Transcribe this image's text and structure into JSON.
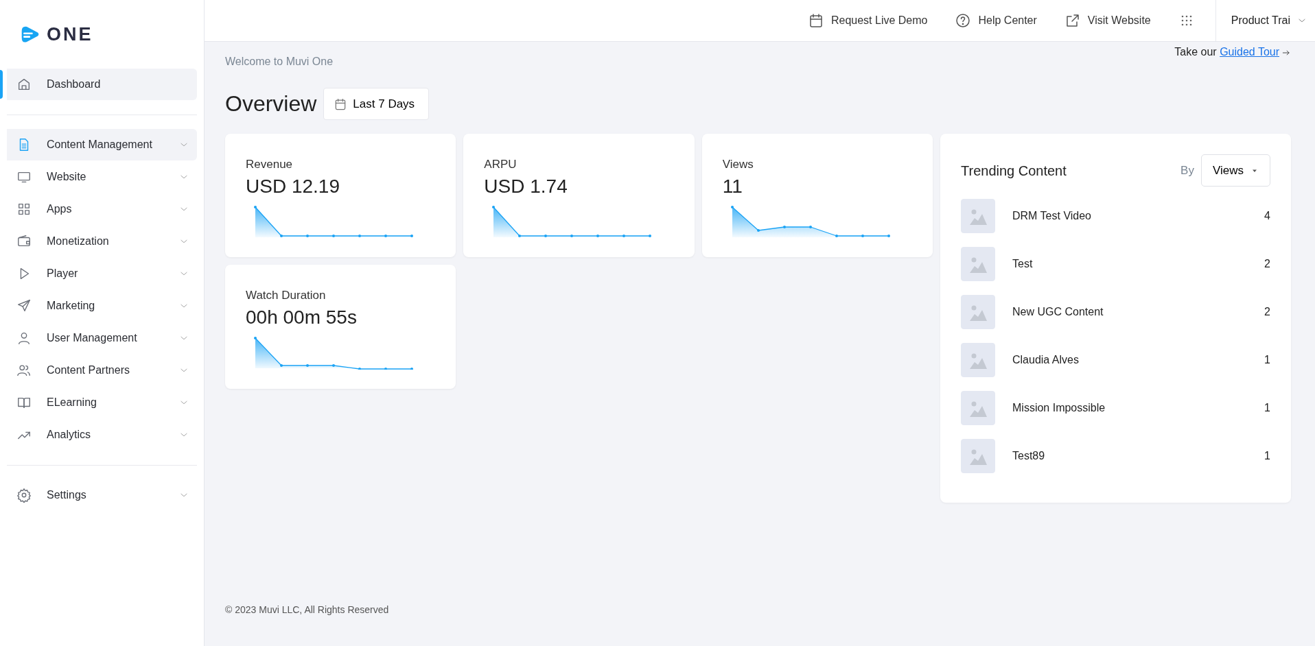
{
  "logo": {
    "text": "ONE"
  },
  "sidebar": {
    "sections": [
      {
        "items": [
          {
            "label": "Dashboard",
            "kind": "home",
            "selected": true,
            "hovered": false,
            "has_submenu": false
          }
        ]
      },
      {
        "items": [
          {
            "label": "Content Management",
            "kind": "document",
            "selected": false,
            "hovered": true,
            "has_submenu": true
          },
          {
            "label": "Website",
            "kind": "monitor",
            "selected": false,
            "hovered": false,
            "has_submenu": true
          },
          {
            "label": "Apps",
            "kind": "grid",
            "selected": false,
            "hovered": false,
            "has_submenu": true
          },
          {
            "label": "Monetization",
            "kind": "wallet",
            "selected": false,
            "hovered": false,
            "has_submenu": true
          },
          {
            "label": "Player",
            "kind": "play",
            "selected": false,
            "hovered": false,
            "has_submenu": true
          },
          {
            "label": "Marketing",
            "kind": "send",
            "selected": false,
            "hovered": false,
            "has_submenu": true
          },
          {
            "label": "User Management",
            "kind": "user",
            "selected": false,
            "hovered": false,
            "has_submenu": true
          },
          {
            "label": "Content Partners",
            "kind": "users",
            "selected": false,
            "hovered": false,
            "has_submenu": true
          },
          {
            "label": "ELearning",
            "kind": "book",
            "selected": false,
            "hovered": false,
            "has_submenu": true
          },
          {
            "label": "Analytics",
            "kind": "trend",
            "selected": false,
            "hovered": false,
            "has_submenu": true
          }
        ]
      },
      {
        "items": [
          {
            "label": "Settings",
            "kind": "gear",
            "selected": false,
            "hovered": false,
            "has_submenu": true
          }
        ]
      }
    ]
  },
  "header": {
    "links": [
      {
        "label": "Request Live Demo",
        "kind": "calendar"
      },
      {
        "label": "Help Center",
        "kind": "help"
      },
      {
        "label": "Visit Website",
        "kind": "external"
      }
    ],
    "account": {
      "label": "Product Trai"
    }
  },
  "greeting": {
    "subtitle": "Welcome to Muvi One"
  },
  "tour": {
    "prefix": "Take our",
    "link": "Guided Tour"
  },
  "overview": {
    "title": "Overview",
    "range": "Last 7 Days"
  },
  "metrics": [
    {
      "label": "Revenue",
      "value": "USD 12.19"
    },
    {
      "label": "ARPU",
      "value": "USD 1.74"
    },
    {
      "label": "Views",
      "value": "11"
    },
    {
      "label": "Watch Duration",
      "value": "00h 00m 55s"
    }
  ],
  "trending": {
    "title": "Trending Content",
    "by_label": "By",
    "sort": "Views",
    "items": [
      {
        "title": "DRM Test Video",
        "count": "4"
      },
      {
        "title": "Test",
        "count": "2"
      },
      {
        "title": "New UGC Content",
        "count": "2"
      },
      {
        "title": "Claudia Alves",
        "count": "1"
      },
      {
        "title": "Mission Impossible",
        "count": "1"
      },
      {
        "title": "Test89",
        "count": "1"
      }
    ]
  },
  "footer": {
    "text": "© 2023 Muvi LLC, All Rights Reserved"
  }
}
